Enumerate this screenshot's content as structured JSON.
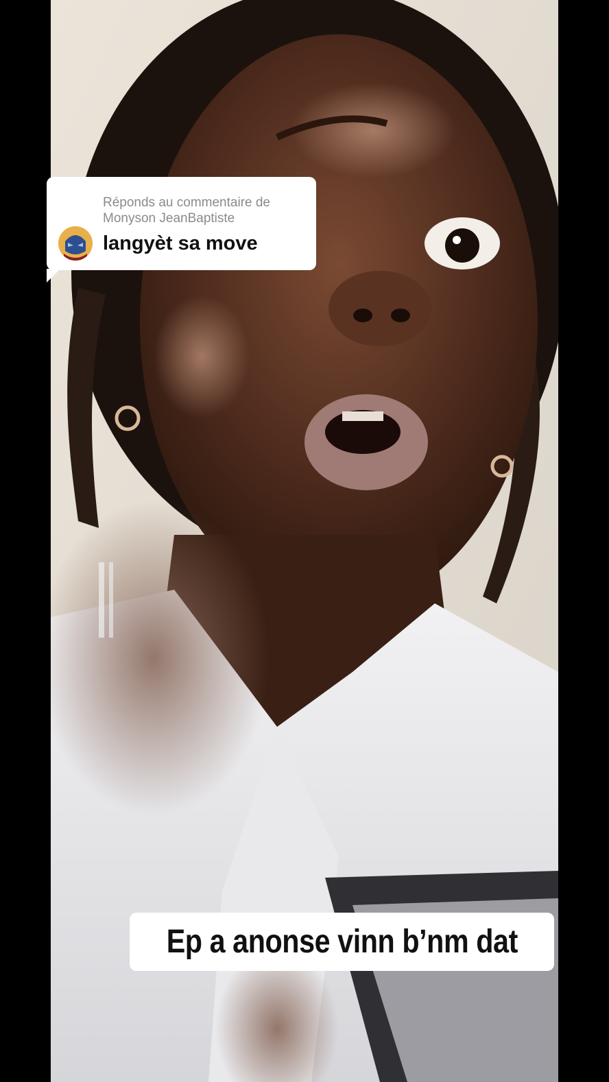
{
  "reply": {
    "label": "Réponds au commentaire de Monyson JeanBaptiste",
    "comment": "langyèt sa move",
    "avatar_icon": "superhero-mask-avatar-icon"
  },
  "caption": {
    "text": "Ep a anonse vinn b’nm dat"
  },
  "video": {
    "description_icon": "video-frame"
  },
  "colors": {
    "bubble_bg": "#ffffff",
    "label_text": "#8a8a8a",
    "comment_text": "#111111",
    "background_bars": "#000000"
  }
}
